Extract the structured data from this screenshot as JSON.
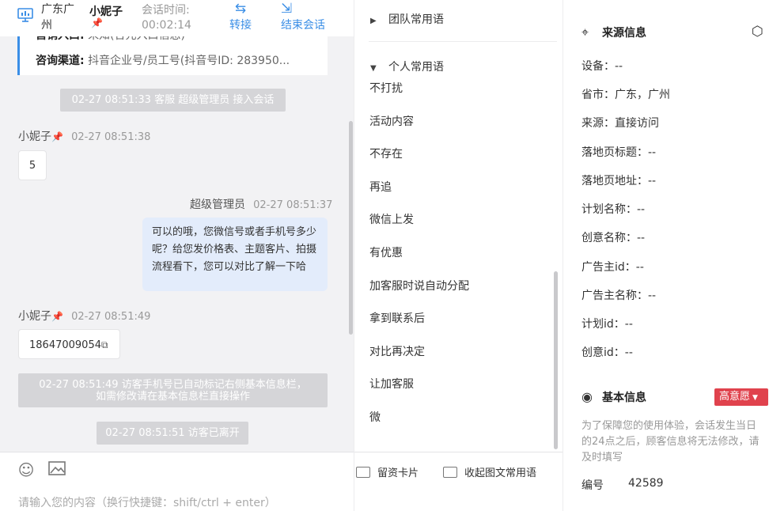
{
  "header": {
    "location": "广东广州",
    "visitor_name": "小妮子",
    "visitor_badge_icon": "red-pin-icon",
    "session_time_label": "会话时间:",
    "session_time": "00:02:14",
    "transfer_label": "转接",
    "end_label": "结束会话"
  },
  "info_card": {
    "row1_label": "营销入口:",
    "row1_value": "未知(合元入口信息)",
    "row2_label": "咨询渠道:",
    "row2_value": "抖音企业号/员工号(抖音号ID: 283950..."
  },
  "messages": {
    "sys1": "02-27 08:51:33 客服 超级管理员 接入会话",
    "msg1_name": "小妮子",
    "msg1_time": "02-27 08:51:38",
    "msg1_text": "5",
    "msg2_name": "超级管理员",
    "msg2_time": "02-27 08:51:37",
    "msg2_text": "可以的哦，您微信号或者手机号多少呢？给您发价格表、主题客片、拍摄流程看下，您可以对比了解一下哈",
    "msg3_name": "小妮子",
    "msg3_time": "02-27 08:51:49",
    "msg3_text": "18647009054",
    "sys2_line1": "02-27 08:51:49 访客手机号已自动标记右侧基本信息栏，",
    "sys2_line2": "如需修改请在基本信息栏直接操作",
    "sys3": "02-27 08:51:51 访客已离开"
  },
  "input": {
    "placeholder": "请输入您的内容（换行快捷键：shift/ctrl + enter）"
  },
  "phrases": {
    "team_header": "团队常用语",
    "personal_header": "个人常用语",
    "items": [
      "不打扰",
      "活动内容",
      "不存在",
      "再追",
      "微信上发",
      "有优惠",
      "加客服时说自动分配",
      "拿到联系后",
      "对比再决定",
      "让加客服",
      "微"
    ],
    "card_button": "留资卡片",
    "collapse_button": "收起图文常用语"
  },
  "source_info": {
    "title": "来源信息",
    "rows": [
      "设备：--",
      "省市：广东，广州",
      "来源：直接访问",
      "落地页标题：--",
      "落地页地址：--",
      "计划名称：--",
      "创意名称：--",
      "广告主id：--",
      "广告主名称：--",
      "计划id：--",
      "创意id：--"
    ]
  },
  "basic_info": {
    "title": "基本信息",
    "intent_badge": "高意愿",
    "note": "为了保障您的使用体验，会话发生当日的24点之后，顾客信息将无法修改，请及时填写",
    "code_label": "编号",
    "code_value": "42589"
  },
  "colors": {
    "accent": "#3a8ee6",
    "badge_red": "#e0424d",
    "agent_bubble": "#e3ecfb",
    "system_msg": "#d5d5d8"
  }
}
